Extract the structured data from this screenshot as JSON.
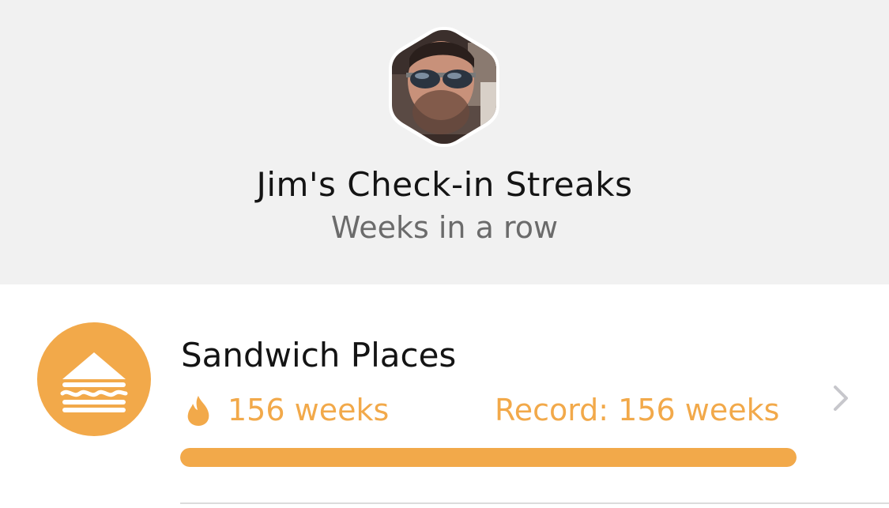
{
  "header": {
    "title": "Jim's Check-in Streaks",
    "subtitle": "Weeks in a row",
    "avatar_icon": "user-avatar-photo"
  },
  "streaks": [
    {
      "category": "Sandwich Places",
      "category_icon": "sandwich-icon",
      "current": "156 weeks",
      "current_icon": "flame-icon",
      "record": "Record: 156 weeks",
      "progress": 1.0,
      "chevron_icon": "chevron-right-icon"
    }
  ],
  "colors": {
    "accent": "#f2a94a",
    "header_bg": "#f1f1f1",
    "title_text": "#141414",
    "subtitle_text": "#6b6b6b",
    "chevron": "#c7c7cc"
  }
}
